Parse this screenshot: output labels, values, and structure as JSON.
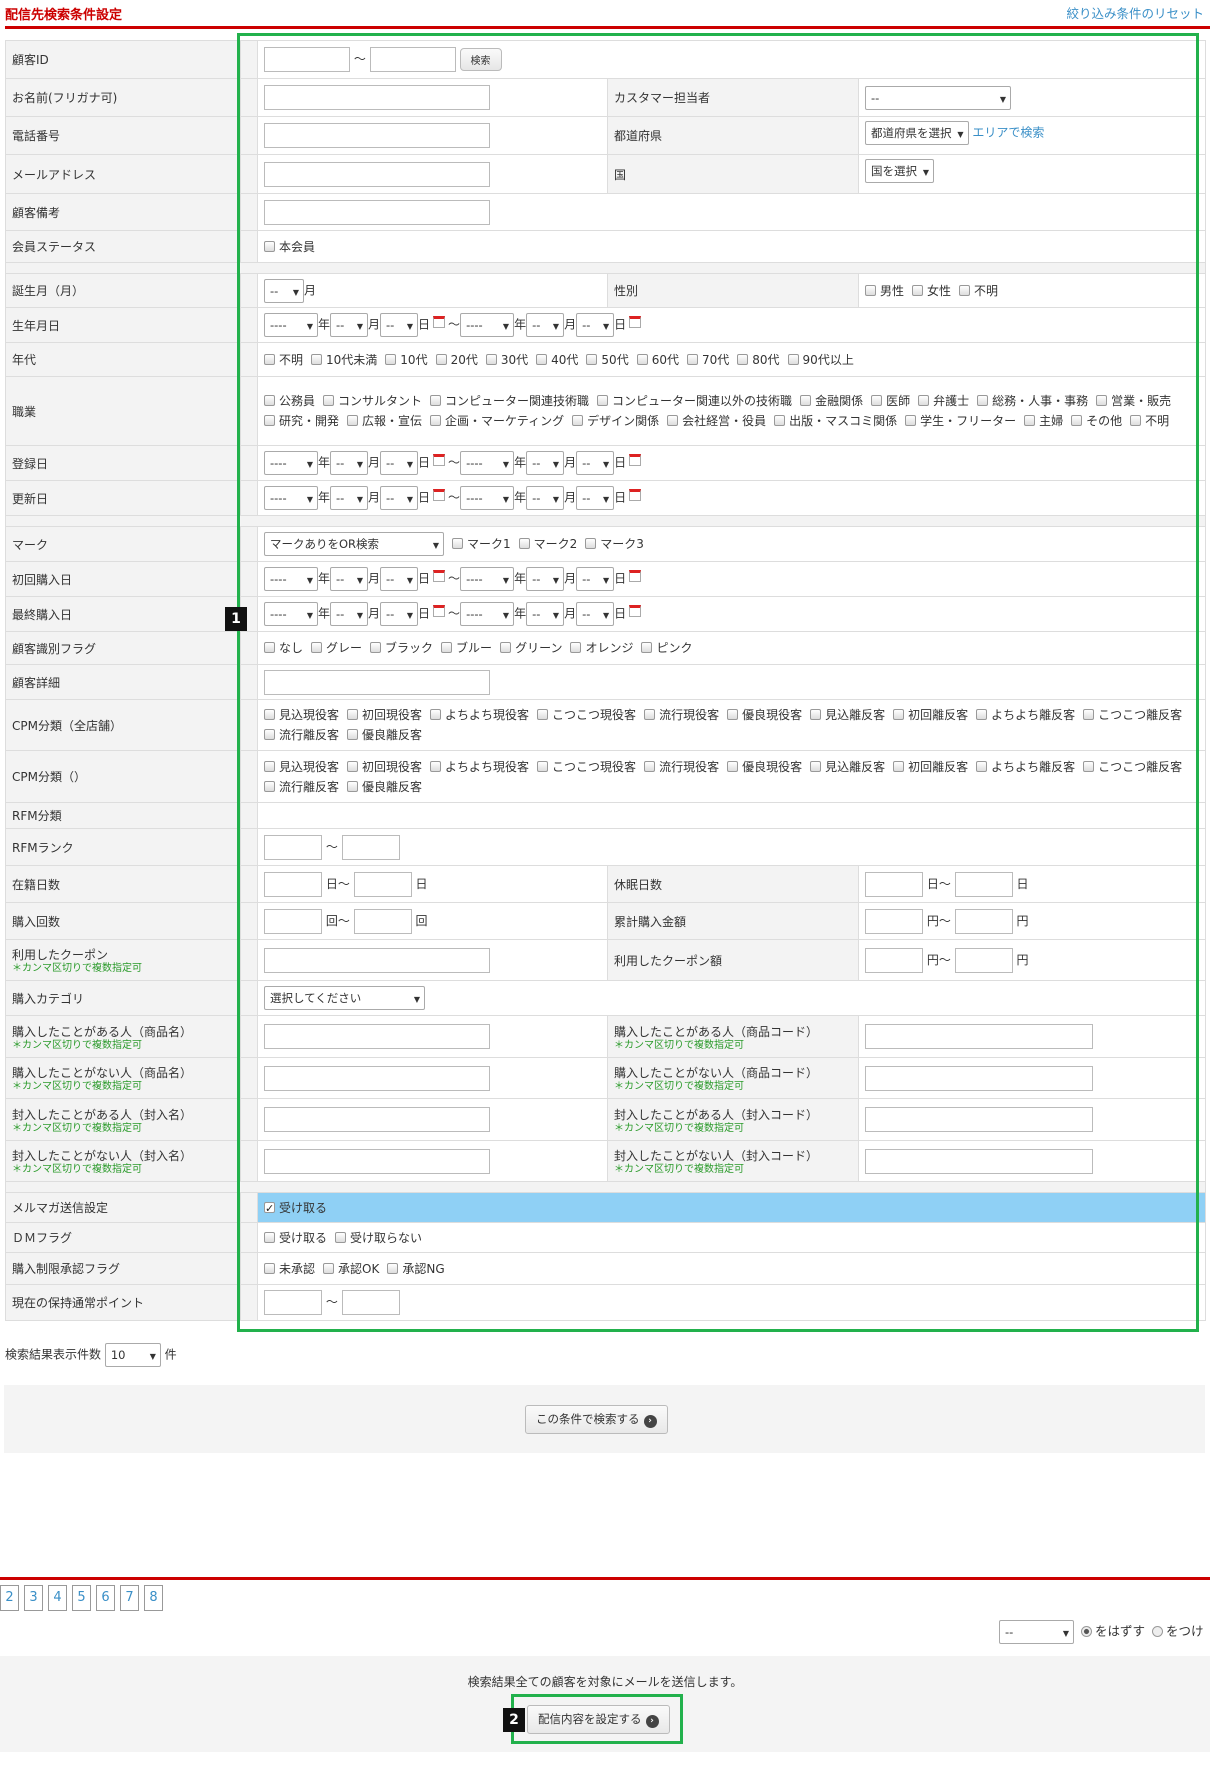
{
  "header": {
    "title": "配信先検索条件設定",
    "reset_link": "絞り込み条件のリセット"
  },
  "common": {
    "tilde": "～",
    "year": "年",
    "month": "月",
    "day": "日",
    "year_ph": "----",
    "md_ph": "--",
    "comma_note": "＊カンマ区切りで複数指定可",
    "unit_day": "日",
    "unit_times": "回",
    "unit_yen": "円"
  },
  "form": {
    "customer_id": "顧客ID",
    "search_btn": "検索",
    "name": "お名前(フリガナ可)",
    "staff": "カスタマー担当者",
    "staff_value": "--",
    "phone": "電話番号",
    "pref": "都道府県",
    "pref_select": "都道府県を選択",
    "area_link": "エリアで検索",
    "email": "メールアドレス",
    "country": "国",
    "country_select": "国を選択",
    "note": "顧客備考",
    "status": "会員ステータス",
    "status_opts": [
      "本会員"
    ],
    "birth_month": "誕生月（月）",
    "birth_month_value": "--",
    "gender": "性別",
    "gender_opts": [
      "男性",
      "女性",
      "不明"
    ],
    "birthday": "生年月日",
    "age": "年代",
    "age_opts": [
      "不明",
      "10代未満",
      "10代",
      "20代",
      "30代",
      "40代",
      "50代",
      "60代",
      "70代",
      "80代",
      "90代以上"
    ],
    "job": "職業",
    "job_opts": [
      "公務員",
      "コンサルタント",
      "コンピューター関連技術職",
      "コンピューター関連以外の技術職",
      "金融関係",
      "医師",
      "弁護士",
      "総務・人事・事務",
      "営業・販売",
      "研究・開発",
      "広報・宣伝",
      "企画・マーケティング",
      "デザイン関係",
      "会社経営・役員",
      "出版・マスコミ関係",
      "学生・フリーター",
      "主婦",
      "その他",
      "不明"
    ],
    "registered": "登録日",
    "updated": "更新日",
    "mark": "マーク",
    "mark_select": "マークありをOR検索",
    "mark_opts": [
      "マーク1",
      "マーク2",
      "マーク3"
    ],
    "first_purchase": "初回購入日",
    "last_purchase": "最終購入日",
    "flag": "顧客識別フラグ",
    "flag_opts": [
      "なし",
      "グレー",
      "ブラック",
      "ブルー",
      "グリーン",
      "オレンジ",
      "ピンク"
    ],
    "detail": "顧客詳細",
    "cpm_all": "CPM分類（全店舗）",
    "cpm": "CPM分類（）",
    "cpm_opts": [
      "見込現役客",
      "初回現役客",
      "よちよち現役客",
      "こつこつ現役客",
      "流行現役客",
      "優良現役客",
      "見込離反客",
      "初回離反客",
      "よちよち離反客",
      "こつこつ離反客",
      "流行離反客",
      "優良離反客"
    ],
    "rfm_class": "RFM分類",
    "rfm_rank": "RFMランク",
    "tenure": "在籍日数",
    "dormant": "休眠日数",
    "purchase_count": "購入回数",
    "total_amount": "累計購入金額",
    "coupon": "利用したクーポン",
    "coupon_amount": "利用したクーポン額",
    "category": "購入カテゴリ",
    "category_select": "選択してください",
    "bought_name": "購入したことがある人（商品名）",
    "bought_code": "購入したことがある人（商品コード）",
    "not_bought_name": "購入したことがない人（商品名）",
    "not_bought_code": "購入したことがない人（商品コード）",
    "enclosed_name": "封入したことがある人（封入名）",
    "enclosed_code": "封入したことがある人（封入コード）",
    "not_enclosed_name": "封入したことがない人（封入名）",
    "not_enclosed_code": "封入したことがない人（封入コード）",
    "mailmag": "メルマガ送信設定",
    "mailmag_opts": [
      "受け取る"
    ],
    "dm": "ＤＭフラグ",
    "dm_opts": [
      "受け取る",
      "受け取らない"
    ],
    "restrict": "購入制限承認フラグ",
    "restrict_opts": [
      "未承認",
      "承認OK",
      "承認NG"
    ],
    "points": "現在の保持通常ポイント"
  },
  "results": {
    "label": "検索結果表示件数",
    "value": "10",
    "unit": "件"
  },
  "search_button": "この条件で検索する",
  "pagination": [
    "2",
    "3",
    "4",
    "5",
    "6",
    "7",
    "8"
  ],
  "bulk": {
    "select": "--",
    "radios": [
      "をはずす",
      "をつけ"
    ]
  },
  "send": {
    "note": "検索結果全ての顧客を対象にメールを送信します。",
    "button": "配信内容を設定する"
  },
  "markers": [
    "1",
    "2"
  ]
}
